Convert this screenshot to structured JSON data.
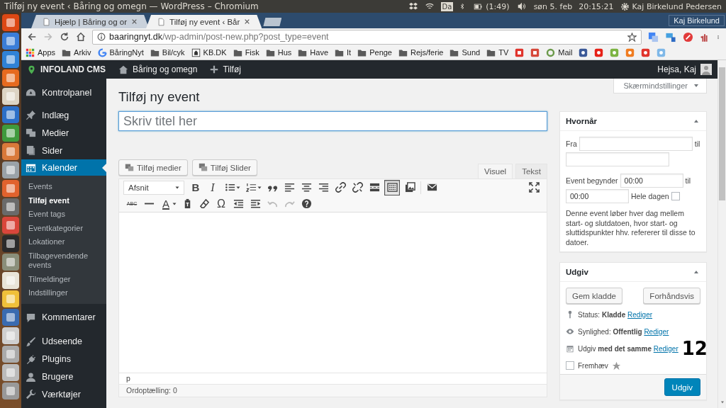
{
  "desktop_panel": {
    "window_title": "Tilføj ny event ‹ Båring og omegn — WordPress – Chromium",
    "keyboard_layout": "Da",
    "battery_time": "(1:49)",
    "date": "søn 5. feb",
    "time": "20:15:21",
    "user_name": "Kaj Birkelund Pedersen"
  },
  "browser": {
    "tabs": [
      {
        "title": "Hjælp | Båring og or",
        "selected": false
      },
      {
        "title": "Tilføj ny event ‹ Bår",
        "selected": true
      }
    ],
    "profile_name": "Kaj Birkelund",
    "url_host": "baaringnyt.dk",
    "url_path": "/wp-admin/post-new.php?post_type=event",
    "bookmarks": [
      {
        "label": "Apps",
        "kind": "apps"
      },
      {
        "label": "Arkiv",
        "kind": "folder"
      },
      {
        "label": "BåringNyt",
        "kind": "google"
      },
      {
        "label": "Bil/cyk",
        "kind": "folder"
      },
      {
        "label": "KB.DK",
        "kind": "site"
      },
      {
        "label": "Fisk",
        "kind": "folder"
      },
      {
        "label": "Hus",
        "kind": "folder"
      },
      {
        "label": "Have",
        "kind": "folder"
      },
      {
        "label": "It",
        "kind": "folder"
      },
      {
        "label": "Penge",
        "kind": "folder"
      },
      {
        "label": "Rejs/ferie",
        "kind": "folder"
      },
      {
        "label": "Sund",
        "kind": "folder"
      },
      {
        "label": "TV",
        "kind": "folder"
      },
      {
        "label": "Mail",
        "kind": "ring"
      }
    ]
  },
  "admin_bar": {
    "brand": "INFOLAND CMS",
    "site_name": "Båring og omegn",
    "new_label": "Tilføj",
    "greeting": "Hejsa, Kaj"
  },
  "sidebar": {
    "items": [
      {
        "label": "Kontrolpanel",
        "selected": false
      },
      {
        "label": "Indlæg",
        "selected": false
      },
      {
        "label": "Medier",
        "selected": false
      },
      {
        "label": "Sider",
        "selected": false
      },
      {
        "label": "Kalender",
        "selected": true,
        "children": [
          {
            "label": "Events",
            "selected": false
          },
          {
            "label": "Tilføj event",
            "selected": true
          },
          {
            "label": "Event tags",
            "selected": false
          },
          {
            "label": "Eventkategorier",
            "selected": false
          },
          {
            "label": "Lokationer",
            "selected": false
          },
          {
            "label": "Tilbagevendende events",
            "selected": false
          },
          {
            "label": "Tilmeldinger",
            "selected": false
          },
          {
            "label": "Indstillinger",
            "selected": false
          }
        ]
      },
      {
        "label": "Kommentarer",
        "selected": false
      },
      {
        "label": "Udseende",
        "selected": false
      },
      {
        "label": "Plugins",
        "selected": false
      },
      {
        "label": "Brugere",
        "selected": false
      },
      {
        "label": "Værktøjer",
        "selected": false
      }
    ]
  },
  "screen_options": "Skærmindstillinger",
  "page_title": "Tilføj ny event",
  "title_field": {
    "placeholder": "Skriv titel her"
  },
  "media_buttons": [
    "Tilføj medier",
    "Tilføj Slider"
  ],
  "editor_tabs": [
    {
      "label": "Visuel",
      "selected": true
    },
    {
      "label": "Tekst",
      "selected": false
    }
  ],
  "editor": {
    "format": "Afsnit",
    "bold": "B",
    "italic": "I",
    "strikethrough": "ABC",
    "text_color": "A",
    "special_character": "Ω",
    "toolbar_toggle_on": true,
    "path": "p",
    "word_count": "Ordoptælling: 0"
  },
  "when_box": {
    "title": "Hvornår",
    "from_label": "Fra",
    "to_label": "til",
    "start_label": "Event begynder",
    "start_time": "00:00",
    "end_label": "til",
    "end_time": "00:00",
    "all_day_label": "Hele dagen",
    "all_day": false,
    "note": "Denne event løber hver dag mellem start- og slutdatoen, hvor start- og sluttidspunkter hhv. refererer til disse to datoer."
  },
  "publish_box": {
    "title": "Udgiv",
    "save_draft": "Gem kladde",
    "preview": "Forhåndsvis",
    "rows": [
      {
        "kind": "status",
        "text": "Status: **Kladde**",
        "link": "Rediger"
      },
      {
        "kind": "visibility",
        "text": "Synlighed: **Offentlig**",
        "link": "Rediger"
      },
      {
        "kind": "schedule",
        "text": "Udgiv **med det samme**",
        "link": "Rediger"
      }
    ],
    "featured": {
      "label": "Fremhæv",
      "checked": false
    },
    "publish_button": "Udgiv"
  },
  "annotation": "12"
}
